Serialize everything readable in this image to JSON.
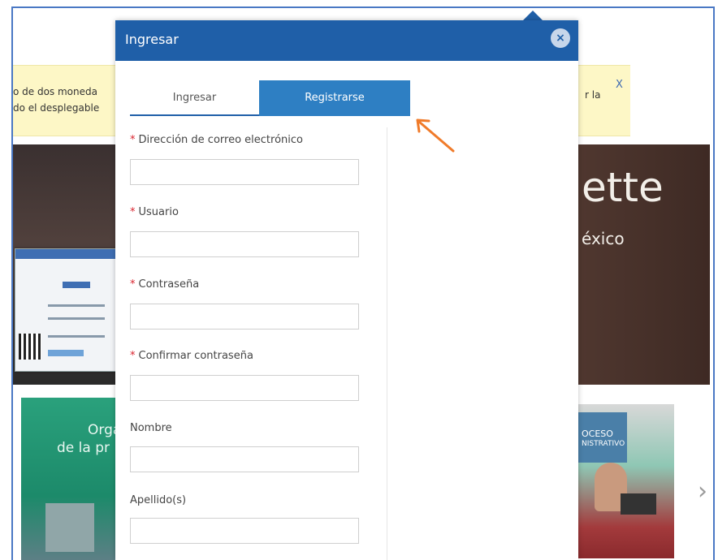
{
  "background": {
    "notice": {
      "left_text_line1": "o de dos moneda",
      "left_text_line2": "do el desplegable",
      "right_text": "r la",
      "close": "X"
    },
    "hero": {
      "title": "ette",
      "subtitle": "éxico"
    },
    "book_left": {
      "line1": "Orga",
      "line2": "de la pr"
    },
    "book_right": {
      "line1": "OCESO",
      "line2": "NISTRATIVO"
    },
    "next_arrow": "›"
  },
  "modal": {
    "title": "Ingresar",
    "close_symbol": "×",
    "tabs": [
      {
        "label": "Ingresar",
        "active": false
      },
      {
        "label": "Registrarse",
        "active": true
      }
    ],
    "fields": [
      {
        "label": "Dirección de correo electrónico",
        "required": true,
        "value": ""
      },
      {
        "label": "Usuario",
        "required": true,
        "value": ""
      },
      {
        "label": "Contraseña",
        "required": true,
        "value": ""
      },
      {
        "label": "Confirmar contraseña",
        "required": true,
        "value": ""
      },
      {
        "label": "Nombre",
        "required": false,
        "value": ""
      },
      {
        "label": "Apellido(s)",
        "required": false,
        "value": ""
      }
    ],
    "required_marker": "*"
  },
  "colors": {
    "header_blue": "#1f5fa8",
    "active_tab": "#2e7fc3",
    "required_red": "#d9232e",
    "annotation_arrow": "#f07b2a",
    "notice_yellow": "#fdf7c6"
  }
}
